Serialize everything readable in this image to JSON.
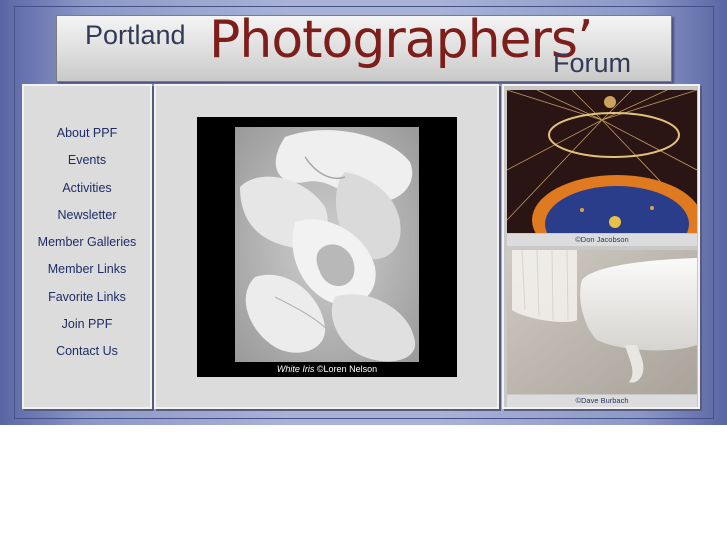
{
  "header": {
    "word_1": "Portland",
    "word_2": "Photographers’",
    "word_3": "Forum"
  },
  "nav": {
    "items": [
      "About PPF",
      "Events",
      "Activities",
      "Newsletter",
      "Member Galleries",
      "Member Links",
      "Favorite Links",
      "Join PPF",
      "Contact Us"
    ]
  },
  "featured": {
    "title": "White Iris",
    "credit": " ©Loren Nelson"
  },
  "sidebar": {
    "photo_1_credit": "©Don Jacobson",
    "photo_2_credit": "©Dave Burbach"
  },
  "colors": {
    "frame": "#8d98c6",
    "title_red": "#7e1e1a",
    "title_dark": "#333a55",
    "nav_text": "#1f2c66",
    "panel": "#dcdcdc"
  }
}
